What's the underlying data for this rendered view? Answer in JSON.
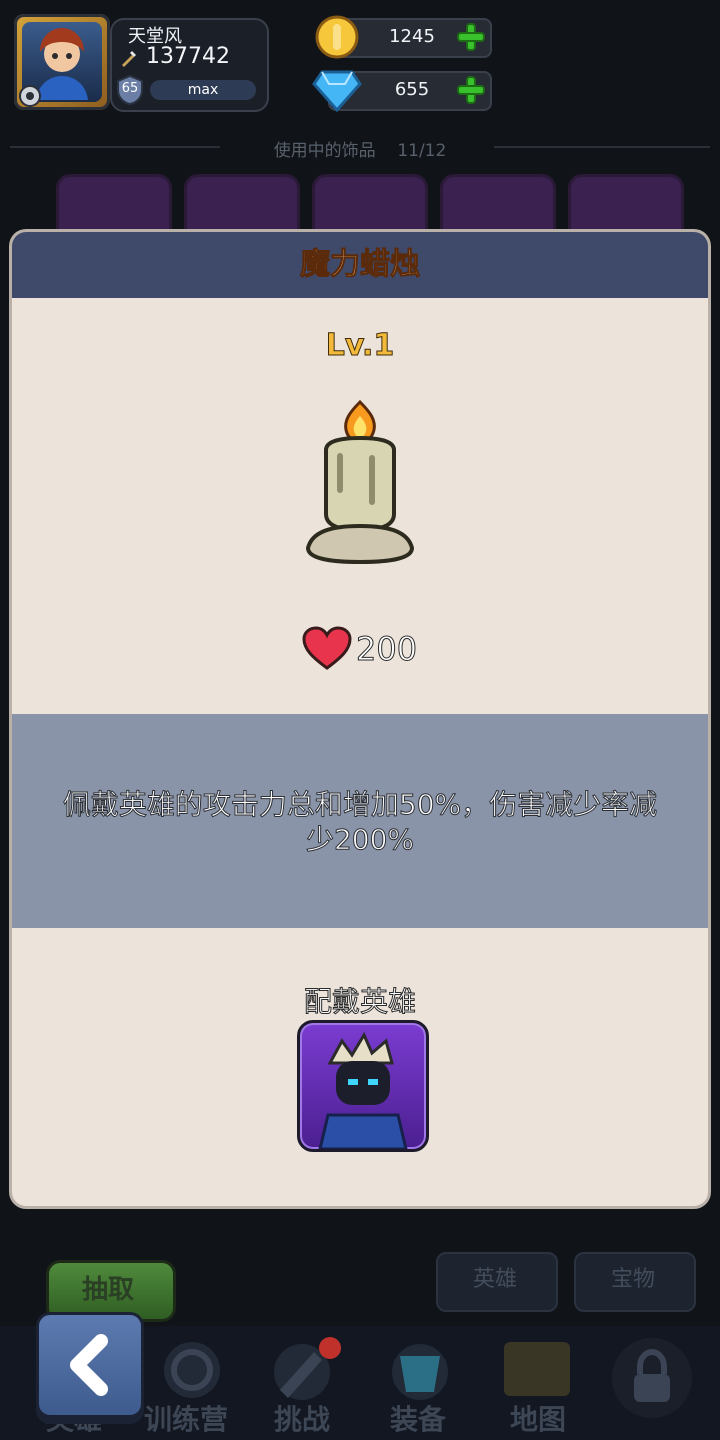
{
  "player": {
    "name": "天堂风",
    "power": "137742",
    "level": "65",
    "level_status": "max"
  },
  "currencies": [
    {
      "name": "gold",
      "value": "1245"
    },
    {
      "name": "diamond",
      "value": "655"
    }
  ],
  "accessories": {
    "in_use_label": "使用中的饰品",
    "count": "11/12"
  },
  "modal": {
    "title": "魔力蜡烛",
    "level": "Lv.1",
    "hp_value": "200",
    "description": "佩戴英雄的攻击力总和增加50%，伤害减少率减少200%",
    "wear_label": "配戴英雄"
  },
  "bottom": {
    "draw_label": "抽取",
    "tabs": [
      "英雄",
      "宝物"
    ],
    "nav": [
      "英雄",
      "训练营",
      "挑战",
      "装备",
      "地图",
      ""
    ]
  },
  "colors": {
    "accent_gold": "#f2b93b",
    "title_orange": "#f6c58a",
    "plus_green": "#39c12d"
  }
}
